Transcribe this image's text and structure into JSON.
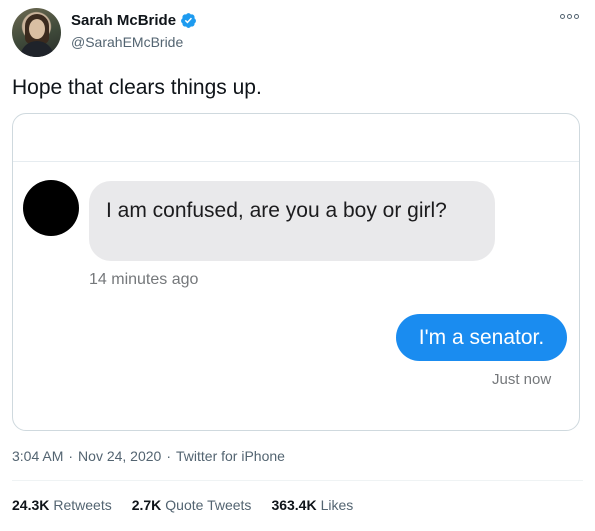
{
  "author": {
    "display_name": "Sarah McBride",
    "handle": "@SarahEMcBride",
    "verified": true
  },
  "tweet": {
    "text": "Hope that clears things up."
  },
  "media": {
    "incoming_message": "I am confused, are you a boy or girl?",
    "incoming_time": "14 minutes ago",
    "outgoing_message": "I'm a senator.",
    "outgoing_time": "Just now",
    "incoming_bubble_color": "#e9e9eb",
    "outgoing_bubble_color": "#1a8cf0"
  },
  "meta": {
    "time": "3:04 AM",
    "separator": "·",
    "date": "Nov 24, 2020",
    "source": "Twitter for iPhone"
  },
  "stats": {
    "retweets_count": "24.3K",
    "retweets_label": "Retweets",
    "quote_count": "2.7K",
    "quote_label": "Quote Tweets",
    "likes_count": "363.4K",
    "likes_label": "Likes"
  },
  "colors": {
    "verified_blue": "#1d9bf0",
    "secondary_text": "#536471"
  }
}
